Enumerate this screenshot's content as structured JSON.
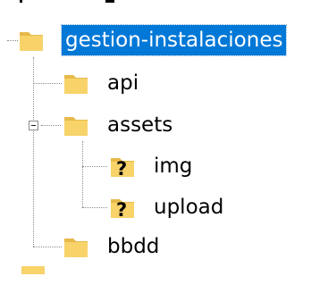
{
  "tree": {
    "items": [
      {
        "label": "gestion-instalaciones",
        "selected": true,
        "icon": "folder-icon"
      },
      {
        "label": "api",
        "icon": "folder-icon"
      },
      {
        "label": "assets",
        "icon": "folder-icon",
        "expander": "collapse"
      },
      {
        "label": "img",
        "icon": "folder-unknown-icon"
      },
      {
        "label": "upload",
        "icon": "folder-unknown-icon"
      },
      {
        "label": "bbdd",
        "icon": "folder-icon"
      }
    ]
  },
  "colors": {
    "selection": "#0078d7",
    "folder": "#f8d36a",
    "folder_dark": "#e6b94a"
  }
}
